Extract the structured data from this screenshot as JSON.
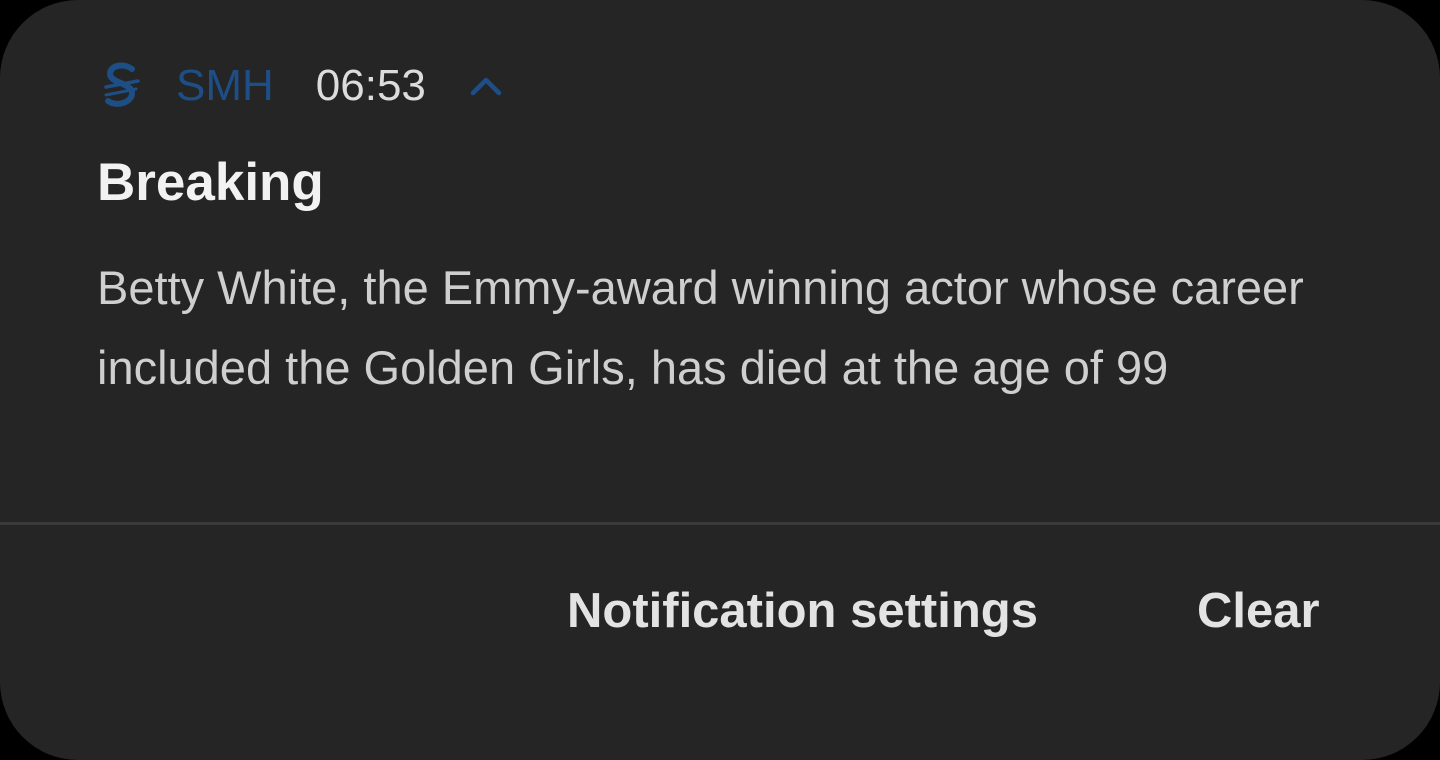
{
  "notification": {
    "app_logo_icon": "smh-logo-icon",
    "app_name": "SMH",
    "time": "06:53",
    "expand_icon": "chevron-up-icon",
    "title": "Breaking",
    "body": "Betty White, the Emmy-award winning actor whose career included the Golden Girls, has died at the age of 99",
    "actions": {
      "settings_label": "Notification settings",
      "clear_label": "Clear"
    }
  },
  "colors": {
    "background": "#252525",
    "app_accent": "#1d4f86",
    "title": "#f2f2f2",
    "body": "#cfcfcf",
    "action": "#e3e3e3"
  }
}
